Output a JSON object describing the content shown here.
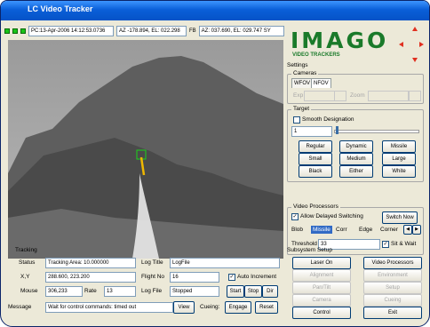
{
  "window": {
    "title": "LC Video Tracker"
  },
  "status_bar": {
    "pc_time": "PC:13-Apr-2006 14:12:53.0736",
    "az_el": "AZ -178.894, EL: 022.298",
    "fb_label": "FB",
    "fb_az_el": "AZ: 037.690, EL: 029.747  SY"
  },
  "logo": {
    "text": "IMAGO",
    "subtitle": "VIDEO TRACKERS"
  },
  "settings": {
    "title": "Settings",
    "cameras": {
      "title": "Cameras",
      "tabs": [
        "WFOV",
        "NFOV"
      ],
      "exp_label": "Exp",
      "zoom_label": "Zoom"
    },
    "target": {
      "title": "Target",
      "smooth_label": "Smooth Designation",
      "value": "1",
      "buttons": [
        [
          "Regular",
          "Dynamic",
          "Missile"
        ],
        [
          "Small",
          "Medium",
          "Large"
        ],
        [
          "Black",
          "Either",
          "White"
        ]
      ]
    },
    "video_processors": {
      "title": "Video Processors",
      "allow_label": "Allow Delayed Switching",
      "switch_button": "Switch Now",
      "tabs": [
        "Blob",
        "Missile",
        "Corr",
        "Edge",
        "Corner"
      ],
      "threshold_label": "Threshold",
      "threshold_value": "33",
      "sit_wait_label": "Sit & Wait"
    }
  },
  "tracking": {
    "title": "Tracking",
    "status_label": "Status",
    "status_value": "Tracking Area: 10.000000",
    "xy_label": "X,Y",
    "xy_value": "288.600, 223.200",
    "mouse_label": "Mouse",
    "mouse_value": "306,233",
    "rate_label": "Rate",
    "rate_value": "13",
    "message_label": "Message",
    "message_value": "Wait for control commands: timed out",
    "log_title_label": "Log Title",
    "log_title_value": "LogFile",
    "flight_no_label": "Flight No",
    "flight_no_value": "16",
    "log_file_label": "Log File",
    "log_file_value": "Stopped",
    "auto_increment_label": "Auto Increment",
    "start_button": "Start",
    "stop_button": "Stop",
    "dir_button": "Dir",
    "view_button": "View",
    "cueing_label": "Cueing:",
    "engage_button": "Engage",
    "reset_button": "Reset"
  },
  "subsystem": {
    "title": "Subsystem Setup",
    "buttons": [
      [
        "Laser On",
        "Video Processors"
      ],
      [
        "Alignment",
        "Environment"
      ],
      [
        "Pan/Tilt",
        "Setup"
      ],
      [
        "Camera",
        "Cueing"
      ],
      [
        "Control",
        "Exit"
      ]
    ]
  },
  "colors": {
    "logo_green": "#1a7a2a",
    "logo_red": "#e03020",
    "led_green": "#19c419",
    "title_blue": "#0a5fd8",
    "selected_blue": "#316ac5"
  }
}
